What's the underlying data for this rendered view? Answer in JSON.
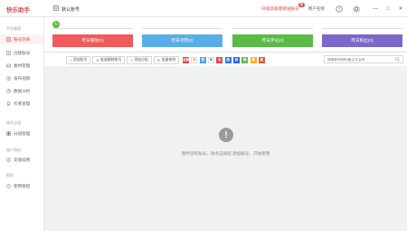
{
  "app": {
    "title": "快乐助手"
  },
  "header": {
    "current_group": "默认账号",
    "vip_link": "升级高级版赠送账号",
    "vip_badge": "赠",
    "user": "用户名称",
    "window_controls": [
      "—",
      "□",
      "✕"
    ]
  },
  "sidebar": {
    "section1": "平台管理",
    "items1": [
      "账号列表",
      "创建账号",
      "素材管理",
      "发布视频",
      "数据分析",
      "作者管理"
    ],
    "section2": "账号分组",
    "items2": [
      "分组管理"
    ],
    "section3": "账户资料",
    "items3": [
      "充值续费"
    ],
    "section4": "帮助",
    "items4": [
      "使用教程"
    ]
  },
  "stats": [
    {
      "label": "昨日播放(0)",
      "color": "#f05a5a"
    },
    {
      "label": "昨日点赞(0)",
      "color": "#5aaee8"
    },
    {
      "label": "昨日评论(0)",
      "color": "#5cba47"
    },
    {
      "label": "昨日粉丝(0)",
      "color": "#7b68c8"
    }
  ],
  "toolbar": {
    "buttons": [
      {
        "label": "添加账号",
        "icon": "+"
      },
      {
        "label": "批量删除账号",
        "icon": "✕"
      },
      {
        "label": "添加分组",
        "icon": "+"
      },
      {
        "label": "批量修改",
        "icon": "✎"
      }
    ],
    "platforms": [
      {
        "name": "all",
        "text": "全部",
        "color": "#e04848"
      },
      {
        "name": "douyin",
        "text": "D",
        "color": "#ffffff",
        "fg": "#e04848"
      },
      {
        "name": "kuaishou",
        "text": "快",
        "color": "#4da6e8"
      },
      {
        "name": "bilibili",
        "text": "B",
        "color": "#ffffff",
        "fg": "#333"
      },
      {
        "name": "toutiao",
        "text": "头",
        "color": "#e04848"
      },
      {
        "name": "xigua",
        "text": "西",
        "color": "#2a7fd8"
      },
      {
        "name": "baijia",
        "text": "百",
        "color": "#2f66d6"
      },
      {
        "name": "wechat",
        "text": "微",
        "color": "#5cba47"
      },
      {
        "name": "video",
        "text": "视",
        "color": "#f5b025"
      },
      {
        "name": "other",
        "text": "其",
        "color": "#e85a2a"
      }
    ],
    "search_placeholder": "搜索账号昵称/备注/平台号"
  },
  "empty": {
    "icon": "!",
    "message": "暂时没有账号，请点击按钮 添加账号，开始使用"
  }
}
